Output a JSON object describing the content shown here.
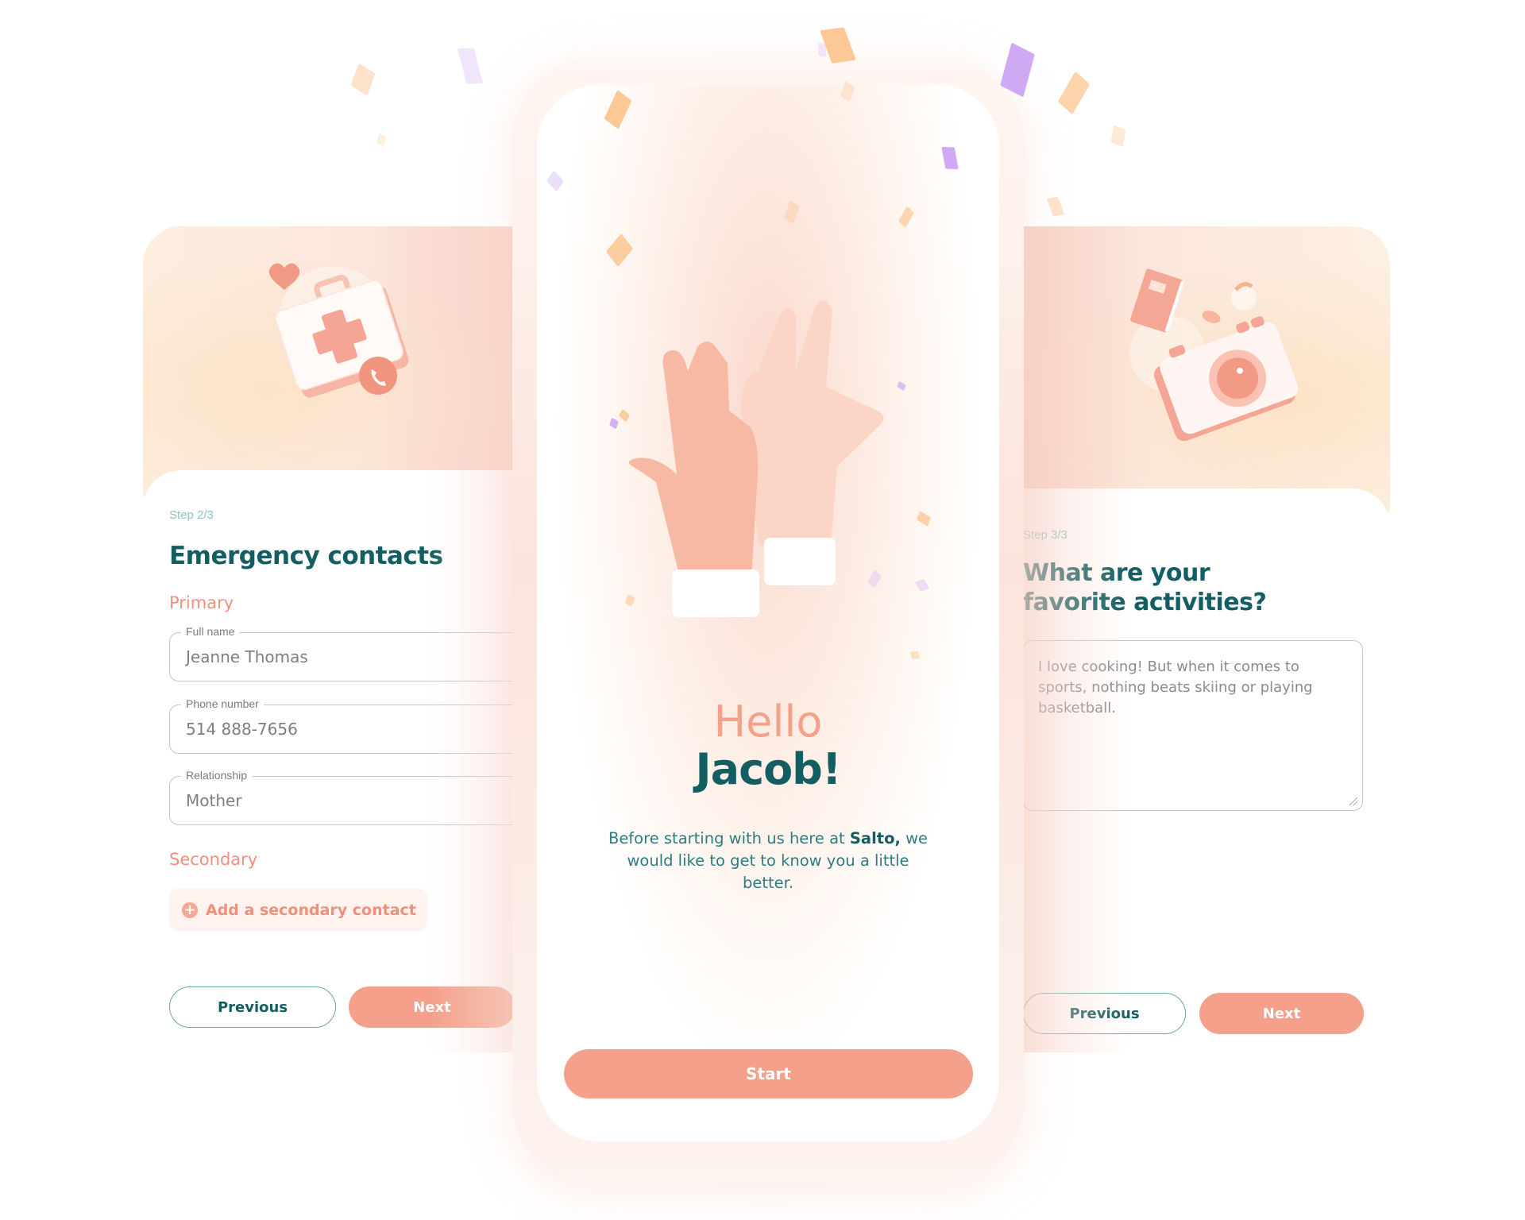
{
  "left_card": {
    "step": "Step 2/3",
    "title": "Emergency contacts",
    "illustration": "first-aid-kit-with-phone-and-heart",
    "primary_label": "Primary",
    "fields": [
      {
        "label": "Full name",
        "value": "Jeanne Thomas"
      },
      {
        "label": "Phone number",
        "value": "514 888-7656"
      },
      {
        "label": "Relationship",
        "value": "Mother"
      }
    ],
    "secondary_label": "Secondary",
    "add_button": {
      "icon": "plus-circle-icon",
      "label": "Add a secondary contact"
    },
    "previous_label": "Previous",
    "next_label": "Next"
  },
  "center_phone": {
    "illustration": "high-five-hands-with-confetti",
    "greeting": "Hello",
    "name": "Jacob!",
    "intro_before": "Before starting with us here at ",
    "intro_brand": "Salto,",
    "intro_after": " we would like to get to know you a little better.",
    "start_label": "Start"
  },
  "right_card": {
    "step": "Step 3/3",
    "title_line1": "What are your",
    "title_line2": "favorite activities?",
    "illustration": "camera-book-football-ball",
    "answer": "I love cooking! But when it comes to sports, nothing beats skiing or playing basketball.",
    "previous_label": "Previous",
    "next_label": "Next"
  },
  "colors": {
    "primary_teal": "#135e63",
    "accent_coral": "#f4a08a",
    "section_coral": "#f0907a",
    "step_teal_light": "#8fc3c3",
    "confetti_orange": "#fcc896",
    "confetti_purple": "#cfa9f3"
  }
}
